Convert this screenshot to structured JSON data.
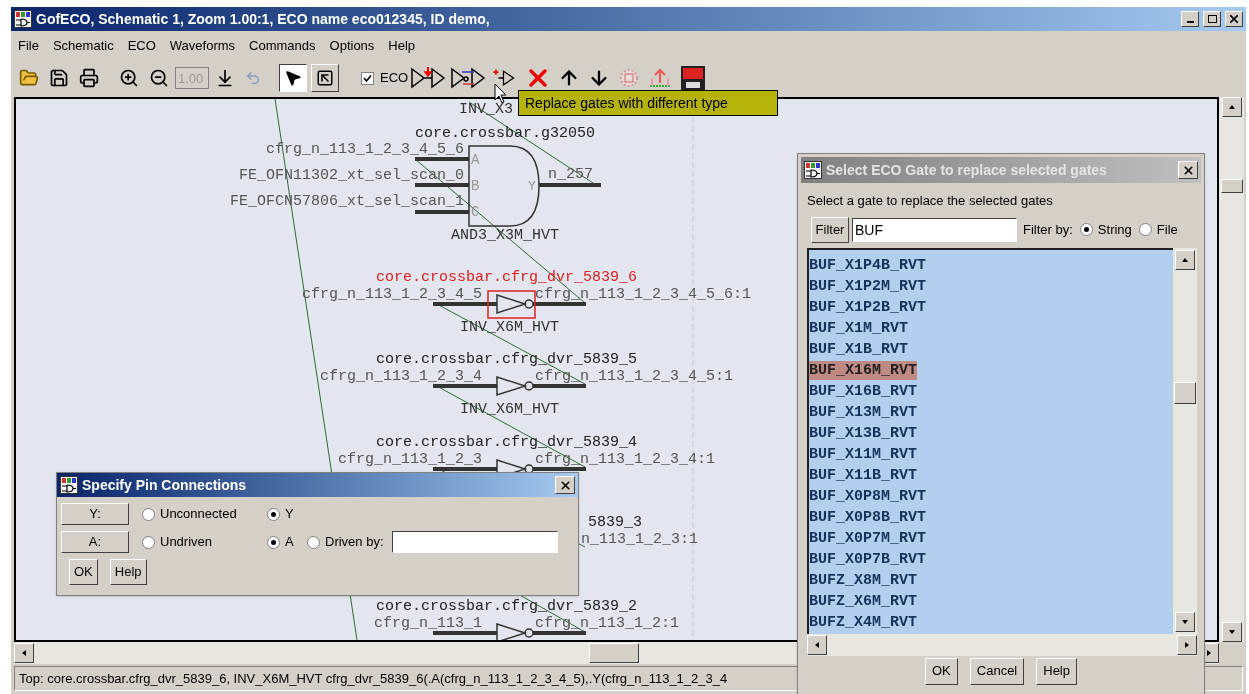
{
  "window": {
    "title": "GofECO, Schematic 1, Zoom 1.00:1, ECO name eco012345, ID demo,"
  },
  "menu": [
    "File",
    "Schematic",
    "ECO",
    "Waveforms",
    "Commands",
    "Options",
    "Help"
  ],
  "toolbar": {
    "zoom": {
      "value": "1.00",
      "disabled": true
    },
    "modes": [
      {
        "selected": true
      },
      {
        "selected": false
      }
    ],
    "eco": {
      "label": "ECO",
      "checked": true
    }
  },
  "tooltip": "Replace gates with different type",
  "schematic": {
    "labels": [
      "INV_X3"
    ],
    "gates": [
      {
        "kind": "and3",
        "instance": "core.crossbar.g32050",
        "cell": "AND3_X3M_HVT",
        "highlighted": false,
        "inputs": [
          {
            "pin": "A",
            "net": "cfrg_n_113_1_2_3_4_5_6"
          },
          {
            "pin": "B",
            "net": "FE_OFN11302_xt_sel_scan_0"
          },
          {
            "pin": "C",
            "net": "FE_OFCN57806_xt_sel_scan_1"
          }
        ],
        "output": {
          "pin": "Y",
          "net": "n_257"
        }
      },
      {
        "kind": "inverter",
        "instance": "core.crossbar.cfrg_dvr_5839_6",
        "cell": "INV_X6M_HVT",
        "highlighted": true,
        "inputs": [
          {
            "net": "cfrg_n_113_1_2_3_4_5"
          }
        ],
        "output": {
          "net": "cfrg_n_113_1_2_3_4_5_6:1"
        }
      },
      {
        "kind": "inverter",
        "instance": "core.crossbar.cfrg_dvr_5839_5",
        "cell": "INV_X6M_HVT",
        "highlighted": false,
        "inputs": [
          {
            "net": "cfrg_n_113_1_2_3_4"
          }
        ],
        "output": {
          "net": "cfrg_n_113_1_2_3_4_5:1"
        }
      },
      {
        "kind": "inverter",
        "instance": "core.crossbar.cfrg_dvr_5839_4",
        "highlighted": false,
        "inputs": [
          {
            "net": "cfrg_n_113_1_2_3"
          }
        ],
        "output": {
          "net": "cfrg_n_113_1_2_3_4:1"
        }
      },
      {
        "kind": "partial",
        "instance": "5839_3",
        "output": {
          "net": "n_113_1_2_3:1"
        }
      },
      {
        "kind": "inverter",
        "instance": "core.crossbar.cfrg_dvr_5839_2",
        "highlighted": false,
        "inputs": [
          {
            "net": "cfrg_n_113_1"
          }
        ],
        "output": {
          "net": "cfrg_n_113_1_2:1"
        }
      }
    ]
  },
  "status_bar": "Top: core.crossbar.cfrg_dvr_5839_6, INV_X6M_HVT cfrg_dvr_5839_6(.A(cfrg_n_113_1_2_3_4_5),.Y(cfrg_n_113_1_2_3_4",
  "pin_dialog": {
    "title": "Specify Pin Connections",
    "pins": [
      {
        "label": "Y:",
        "options": [
          {
            "label": "Unconnected",
            "selected": false
          },
          {
            "label": "Y",
            "selected": true
          }
        ]
      },
      {
        "label": "A:",
        "options": [
          {
            "label": "Undriven",
            "selected": false
          },
          {
            "label": "A",
            "selected": true
          }
        ],
        "driven_by": {
          "label": "Driven by:",
          "selected": false
        }
      }
    ],
    "buttons": [
      "OK",
      "Help"
    ]
  },
  "gate_dialog": {
    "title": "Select ECO Gate to replace selected gates",
    "prompt": "Select a gate to replace the selected gates",
    "filter_button": "Filter",
    "filter_value": "BUF",
    "filter_by": {
      "label": "Filter by:",
      "options": [
        {
          "label": "String",
          "selected": true
        },
        {
          "label": "File",
          "selected": false
        }
      ]
    },
    "gates": [
      {
        "name": "BUF_X1P4B_RVT",
        "selected": false
      },
      {
        "name": "BUF_X1P2M_RVT",
        "selected": false
      },
      {
        "name": "BUF_X1P2B_RVT",
        "selected": false
      },
      {
        "name": "BUF_X1M_RVT",
        "selected": false
      },
      {
        "name": "BUF_X1B_RVT",
        "selected": false
      },
      {
        "name": "BUF_X16M_RVT",
        "selected": true
      },
      {
        "name": "BUF_X16B_RVT",
        "selected": false
      },
      {
        "name": "BUF_X13M_RVT",
        "selected": false
      },
      {
        "name": "BUF_X13B_RVT",
        "selected": false
      },
      {
        "name": "BUF_X11M_RVT",
        "selected": false
      },
      {
        "name": "BUF_X11B_RVT",
        "selected": false
      },
      {
        "name": "BUF_X0P8M_RVT",
        "selected": false
      },
      {
        "name": "BUF_X0P8B_RVT",
        "selected": false
      },
      {
        "name": "BUF_X0P7M_RVT",
        "selected": false
      },
      {
        "name": "BUF_X0P7B_RVT",
        "selected": false
      },
      {
        "name": "BUFZ_X8M_RVT",
        "selected": false
      },
      {
        "name": "BUFZ_X6M_RVT",
        "selected": false
      },
      {
        "name": "BUFZ_X4M_RVT",
        "selected": false
      }
    ],
    "buttons": [
      "OK",
      "Cancel",
      "Help"
    ]
  }
}
